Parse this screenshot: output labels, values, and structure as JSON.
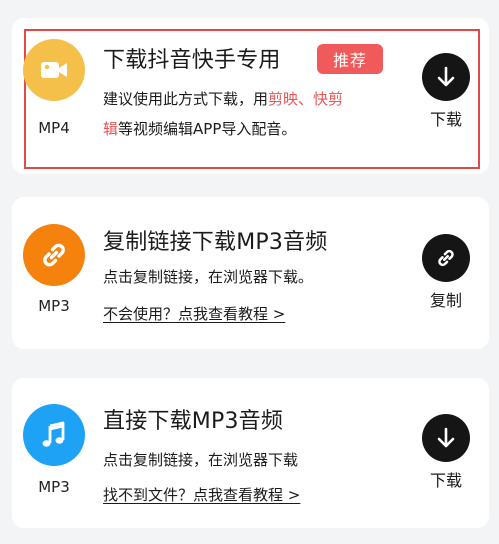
{
  "colors": {
    "background": "#f3f4f6",
    "card": "#ffffff",
    "highlight_border": "#e24848",
    "accent_red": "#e85555",
    "tag_bg": "#f05a5a",
    "mp4_icon_bg": "#f5c04a",
    "link_icon_bg": "#f5820d",
    "music_icon_bg": "#1ea2f5",
    "action_btn_bg": "#151515"
  },
  "options": [
    {
      "icon": "video-camera-icon",
      "format": "MP4",
      "title": "下载抖音快手专用",
      "tag": "推荐",
      "desc_line1_a": "建议使用此方式下载，用",
      "desc_line1_b": "剪映、快剪",
      "desc_line2_a": "辑",
      "desc_line2_b": "等视频编辑APP导入配音。",
      "action_icon": "download-arrow-icon",
      "action_label": "下载"
    },
    {
      "icon": "link-icon",
      "format": "MP3",
      "title": "复制链接下载MP3音频",
      "desc": "点击复制链接，在浏览器下载。",
      "help_link": "不会使用？点我查看教程 >",
      "action_icon": "link-icon",
      "action_label": "复制"
    },
    {
      "icon": "music-note-icon",
      "format": "MP3",
      "title": "直接下载MP3音频",
      "desc": "点击复制链接，在浏览器下载",
      "help_link": "找不到文件？点我查看教程 >",
      "action_icon": "download-arrow-icon",
      "action_label": "下载"
    }
  ]
}
